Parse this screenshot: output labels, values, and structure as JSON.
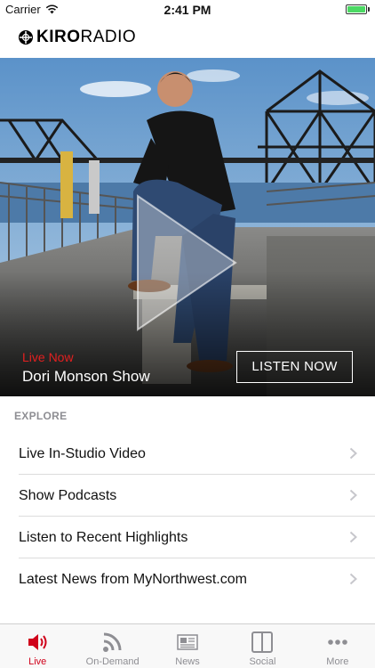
{
  "status_bar": {
    "carrier": "Carrier",
    "time": "2:41 PM"
  },
  "header": {
    "logo_bold": "KIRO",
    "logo_light": "RADIO"
  },
  "hero": {
    "live_label": "Live Now",
    "show_title": "Dori Monson Show",
    "listen_button": "LISTEN NOW"
  },
  "explore": {
    "heading": "EXPLORE",
    "items": [
      {
        "label": "Live In-Studio Video"
      },
      {
        "label": "Show Podcasts"
      },
      {
        "label": "Listen to Recent Highlights"
      },
      {
        "label": "Latest News from MyNorthwest.com"
      }
    ]
  },
  "tab_bar": {
    "tabs": [
      {
        "label": "Live",
        "icon": "speaker-icon",
        "active": true
      },
      {
        "label": "On-Demand",
        "icon": "rss-icon",
        "active": false
      },
      {
        "label": "News",
        "icon": "newspaper-icon",
        "active": false
      },
      {
        "label": "Social",
        "icon": "columns-icon",
        "active": false
      },
      {
        "label": "More",
        "icon": "more-dots-icon",
        "active": false
      }
    ]
  },
  "colors": {
    "accent_red": "#d0021b",
    "live_red": "#e32020",
    "battery_green": "#4cd964",
    "tab_inactive": "#8e8e93"
  }
}
